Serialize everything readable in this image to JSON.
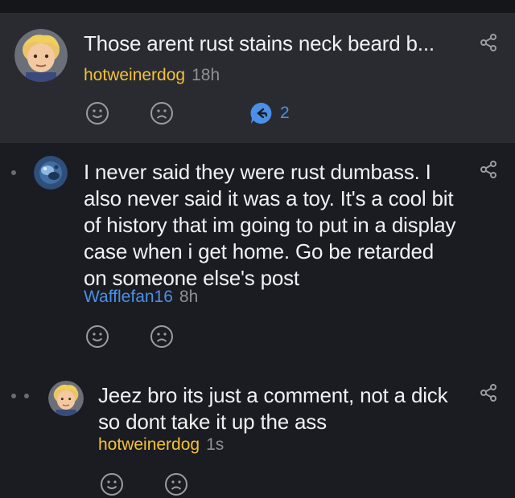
{
  "comments": [
    {
      "text": "Those arent rust stains neck beard b...",
      "username": "hotweinerdog",
      "age": "18h",
      "reply_count": "2",
      "avatar_icon": "cartoon-boy-avatar",
      "username_color": "#f4c137"
    },
    {
      "text": "I never said they were rust dumbass. I also never said it was a toy. It's a cool bit of history that im going to put in a display case when i get home. Go be retarded on someone else's post",
      "username": "Wafflefan16",
      "age": "8h",
      "avatar_icon": "underwater-avatar",
      "username_color": "#4a90e8"
    },
    {
      "text": "Jeez bro its just a comment, not a dick so dont take it up the ass",
      "username": "hotweinerdog",
      "age": "1s",
      "avatar_icon": "cartoon-boy-avatar",
      "username_color": "#f4c137"
    }
  ],
  "colors": {
    "background": "#1b1c21",
    "highlight_background": "#2a2b31",
    "accent_blue": "#4a90e8",
    "icon_gray": "#9a9ca4"
  }
}
